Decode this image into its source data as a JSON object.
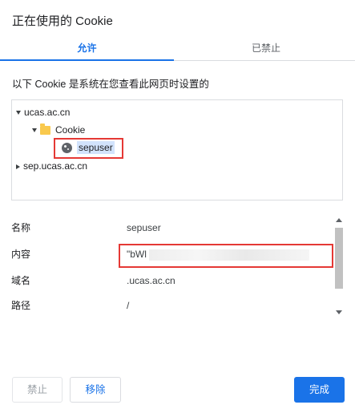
{
  "dialog": {
    "title": "正在使用的 Cookie"
  },
  "tabs": [
    {
      "label": "允许",
      "active": true
    },
    {
      "label": "已禁止",
      "active": false
    }
  ],
  "description": "以下 Cookie 是系统在您查看此网页时设置的",
  "tree": {
    "nodes": [
      {
        "label": "ucas.ac.cn",
        "expanded": true,
        "icon": "arrow-down"
      },
      {
        "label": "Cookie",
        "expanded": true,
        "icon": "folder"
      },
      {
        "label": "sepuser",
        "selected": true,
        "icon": "cookie"
      },
      {
        "label": "sep.ucas.ac.cn",
        "expanded": false,
        "icon": "arrow-right"
      }
    ]
  },
  "details": {
    "rows": [
      {
        "label": "名称",
        "value": "sepuser"
      },
      {
        "label": "内容",
        "value": "\"bWl"
      },
      {
        "label": "域名",
        "value": ".ucas.ac.cn"
      },
      {
        "label": "路径",
        "value": "/"
      }
    ]
  },
  "buttons": {
    "block": "禁止",
    "remove": "移除",
    "done": "完成"
  },
  "colors": {
    "accent": "#1a73e8",
    "highlight": "#e53935",
    "selection": "#d2e3fc"
  }
}
